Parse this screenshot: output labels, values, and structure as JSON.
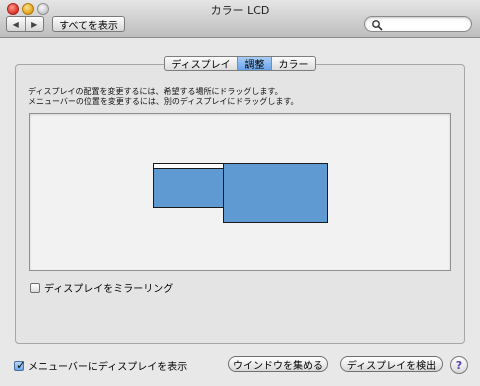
{
  "window": {
    "title": "カラー LCD",
    "controls": [
      "close-button",
      "minimize-button",
      "zoom-button"
    ]
  },
  "toolbar": {
    "back_glyph": "◀",
    "forward_glyph": "▶",
    "show_all_label": "すべてを表示",
    "search": {
      "value": "",
      "placeholder": "",
      "icon": "search-icon"
    }
  },
  "tabs": [
    {
      "label": "ディスプレイ",
      "selected": false
    },
    {
      "label": "調整",
      "selected": true
    },
    {
      "label": "カラー",
      "selected": false
    }
  ],
  "info": {
    "line1": "ディスプレイの配置を変更するには、希望する場所にドラッグします。",
    "line2": "メニューバーの位置を変更するには、別のディスプレイにドラッグします。"
  },
  "arrangement": {
    "display_color": "#5f9ad3",
    "displays": [
      "secondary-display-with-menubar",
      "main-display"
    ]
  },
  "options": {
    "mirror_label": "ディスプレイをミラーリング",
    "mirror_checked": false,
    "show_in_menubar_label": "メニューバーにディスプレイを表示",
    "show_in_menubar_checked": true
  },
  "buttons": {
    "gather_windows": "ウインドウを集める",
    "detect_displays": "ディスプレイを検出",
    "help": "?"
  },
  "colors": {
    "selected_tab": "#6aa3e9",
    "help_accent": "#5a3fb0"
  }
}
